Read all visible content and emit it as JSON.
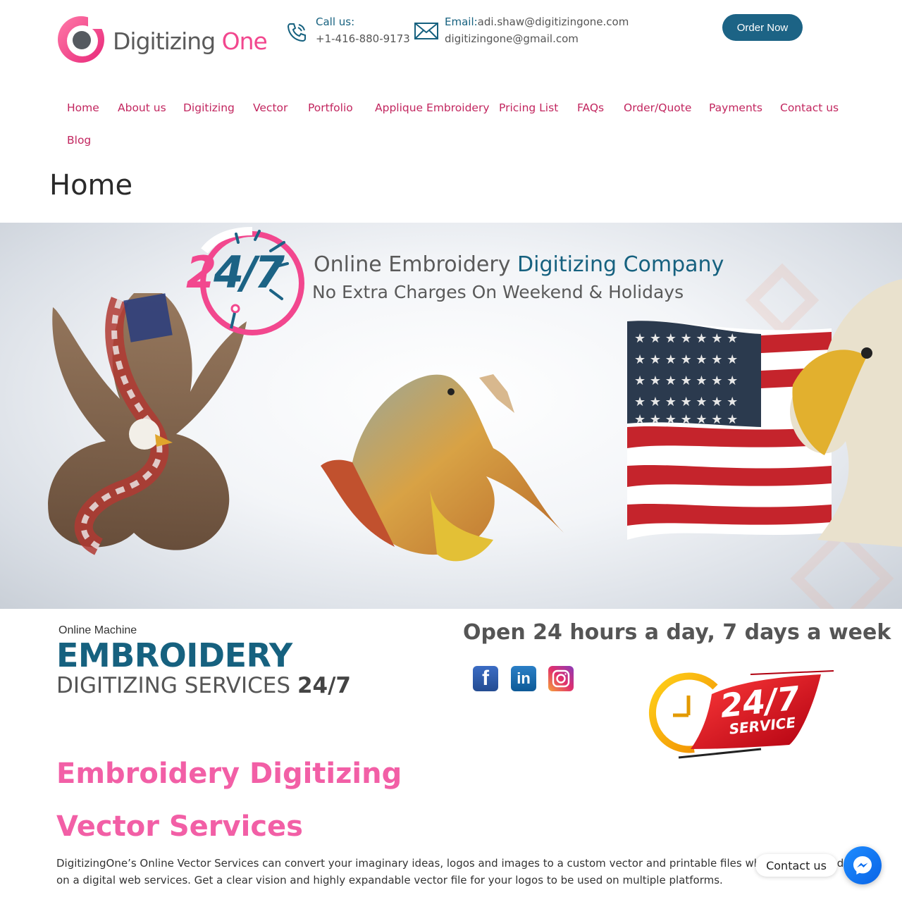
{
  "header": {
    "logo": {
      "word1": "Digitizing",
      "word2": "One"
    },
    "call": {
      "label": "Call us:",
      "value": "+1-416-880-9173"
    },
    "email": {
      "label": "Email:",
      "value1": "adi.shaw@digitizingone.com",
      "value2": "digitizingone@gmail.com"
    },
    "order_label": "Order Now"
  },
  "nav": {
    "items": [
      {
        "label": "Home"
      },
      {
        "label": "About us"
      },
      {
        "label": "Digitizing"
      },
      {
        "label": "Vector"
      },
      {
        "label": "Portfolio"
      },
      {
        "label": "Applique Embroidery"
      },
      {
        "label": "Pricing List"
      },
      {
        "label": "FAQs"
      },
      {
        "label": "Order/Quote"
      },
      {
        "label": "Payments"
      },
      {
        "label": "Contact us"
      },
      {
        "label": "Blog"
      }
    ]
  },
  "page_title": "Home",
  "banner": {
    "badge_text": "24/7",
    "headline_a": "Online Embroidery ",
    "headline_b": "Digitizing Company",
    "subline": "No Extra Charges On Weekend & Holidays"
  },
  "intro": {
    "small": "Online Machine",
    "big": "EMBROIDERY",
    "sub": "DIGITIZING SERVICES ",
    "sub_bold": "24/7"
  },
  "hours": "Open 24 hours a day, 7 days a week",
  "social": [
    {
      "icon": "facebook-icon",
      "glyph": "f"
    },
    {
      "icon": "linkedin-icon",
      "glyph": "in"
    },
    {
      "icon": "instagram-icon"
    }
  ],
  "service_badge": {
    "line1": "24/7",
    "line2": "SERVICE"
  },
  "sections": {
    "embroidery_heading": "Embroidery Digitizing",
    "vector_heading": "Vector Services",
    "vector_text": "DigitizingOne’s Online Vector Services can convert your imaginary ideas, logos and images to a custom vector and printable files which can be used on a digital web services. Get a clear vision and highly expandable vector file for your logos to be used on multiple platforms."
  },
  "chat": {
    "label": "Contact us"
  },
  "colors": {
    "brand_blue": "#16617f",
    "brand_pink": "#f2478e",
    "nav_red": "#c2265f"
  }
}
